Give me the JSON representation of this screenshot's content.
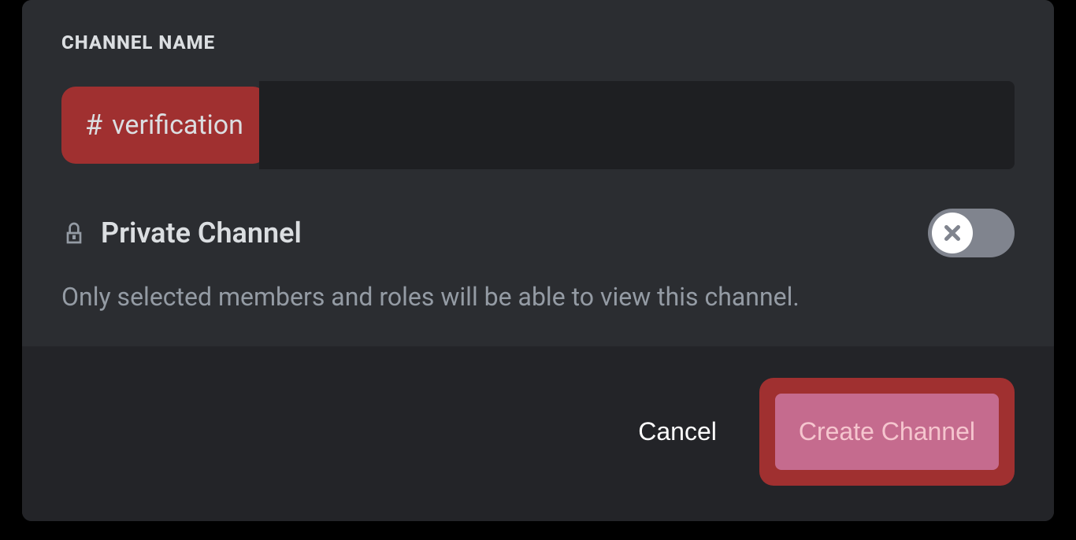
{
  "channel_name": {
    "label": "CHANNEL NAME",
    "prefix": "#",
    "value": "verification"
  },
  "private_channel": {
    "label": "Private Channel",
    "description": "Only selected members and roles will be able to view this channel.",
    "enabled": false
  },
  "actions": {
    "cancel_label": "Cancel",
    "create_label": "Create Channel"
  }
}
